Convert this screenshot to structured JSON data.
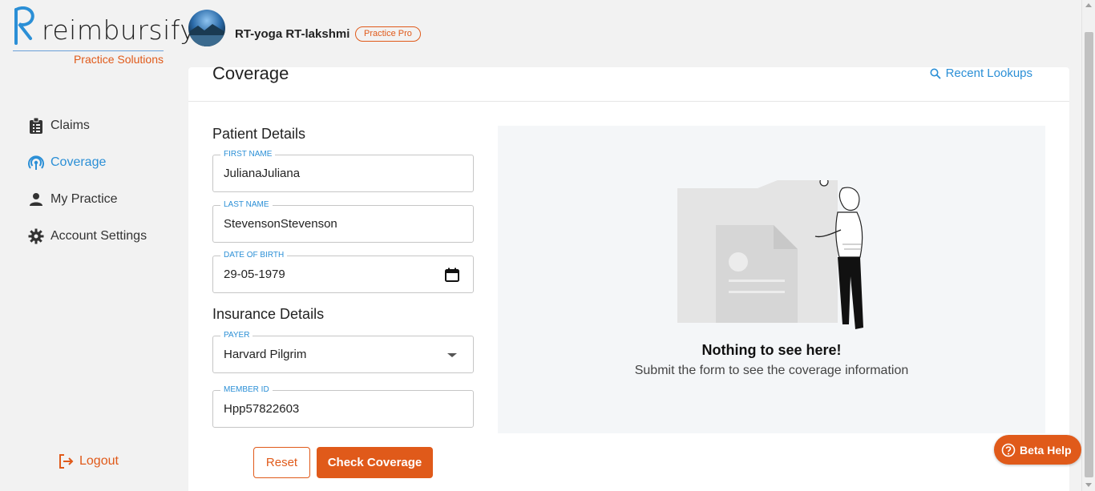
{
  "brand": {
    "name": "reimbursify",
    "subtitle": "Practice Solutions",
    "accent": "#e05a1a",
    "link": "#2b8fd6"
  },
  "header": {
    "user_name": "RT-yoga RT-lakshmi",
    "plan": "Practice Pro"
  },
  "sidebar": {
    "items": [
      {
        "label": "Claims",
        "icon": "clipboard-icon",
        "active": false
      },
      {
        "label": "Coverage",
        "icon": "broadcast-icon",
        "active": true
      },
      {
        "label": "My Practice",
        "icon": "person-icon",
        "active": false
      },
      {
        "label": "Account Settings",
        "icon": "gear-icon",
        "active": false
      }
    ],
    "logout_label": "Logout"
  },
  "main": {
    "title": "Coverage",
    "recent_lookups": "Recent Lookups",
    "patient_section": "Patient Details",
    "insurance_section": "Insurance Details",
    "fields": {
      "first_name": {
        "label": "FIRST NAME",
        "value": "JulianaJuliana"
      },
      "last_name": {
        "label": "LAST NAME",
        "value": "StevensonStevenson"
      },
      "dob": {
        "label": "DATE OF BIRTH",
        "value": "29-05-1979"
      },
      "payer": {
        "label": "PAYER",
        "value": "Harvard Pilgrim"
      },
      "member_id": {
        "label": "MEMBER ID",
        "value": "Hpp57822603"
      }
    },
    "reset_label": "Reset",
    "check_label": "Check Coverage",
    "empty": {
      "title": "Nothing to see here!",
      "subtitle": "Submit the form to see the coverage information"
    }
  },
  "beta_help": "Beta Help"
}
